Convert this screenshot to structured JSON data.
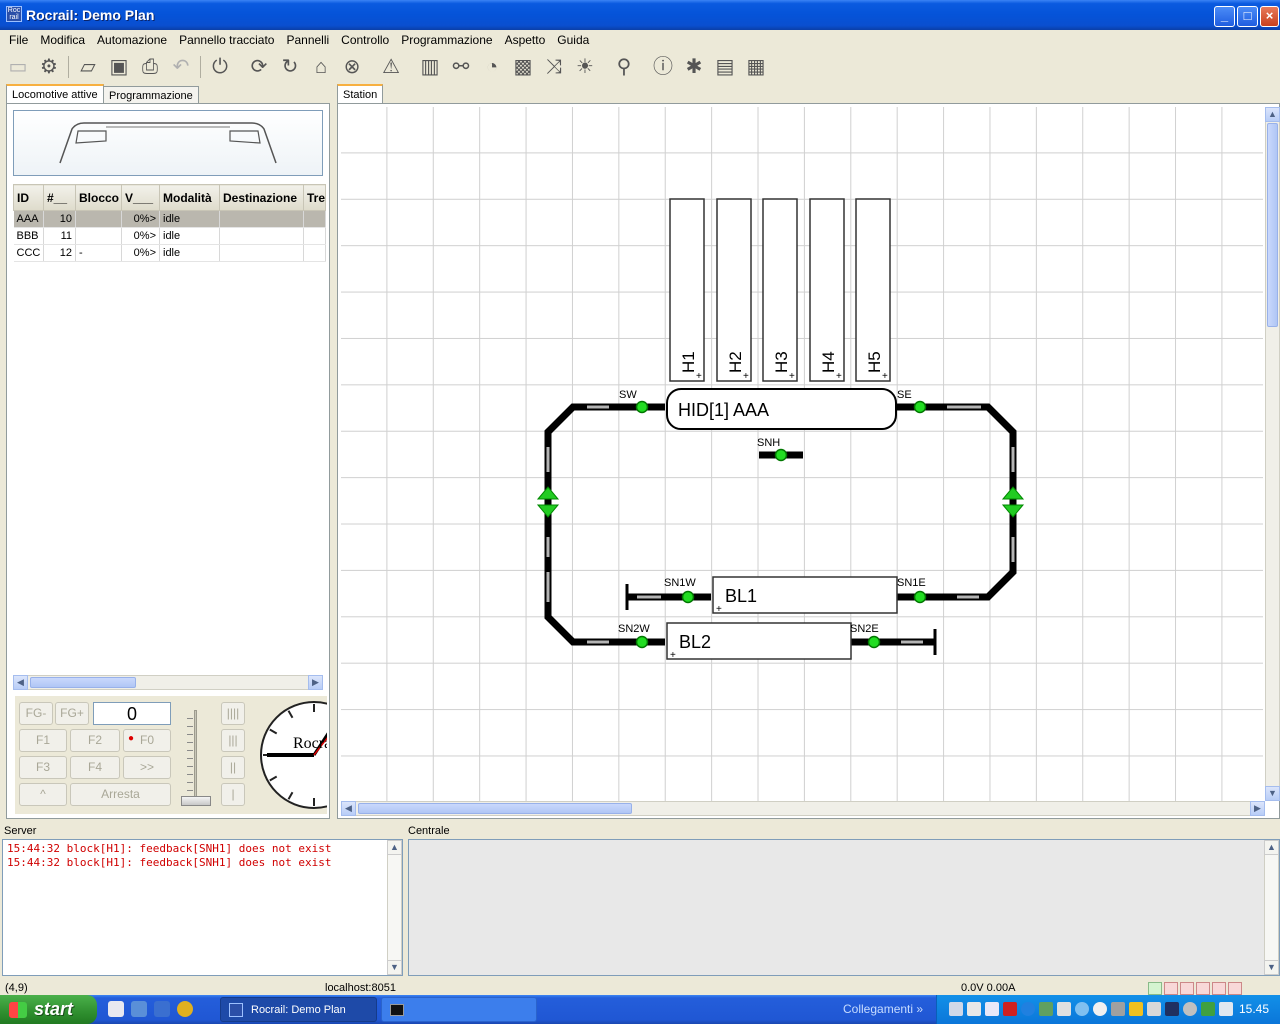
{
  "window": {
    "title": "Rocrail: Demo Plan",
    "app_icon_text": "Roc\nrail"
  },
  "menu": [
    "File",
    "Modifica",
    "Automazione",
    "Pannello tracciato",
    "Pannelli",
    "Controllo",
    "Programmazione",
    "Aspetto",
    "Guida"
  ],
  "left": {
    "tabs": [
      "Locomotive attive",
      "Programmazione"
    ],
    "table": {
      "columns": [
        "ID",
        "#__",
        "Blocco",
        "V___",
        "Modalità",
        "Destinazione",
        "Tre"
      ],
      "rows": [
        {
          "id": "AAA",
          "addr": "10",
          "block": "",
          "speed": "0%>",
          "mode": "idle",
          "dest": "",
          "train": ""
        },
        {
          "id": "BBB",
          "addr": "11",
          "block": "",
          "speed": "0%>",
          "mode": "idle",
          "dest": "",
          "train": ""
        },
        {
          "id": "CCC",
          "addr": "12",
          "block": "-",
          "speed": "0%>",
          "mode": "idle",
          "dest": "",
          "train": ""
        }
      ]
    },
    "controls": {
      "fg_minus": "FG-",
      "fg_plus": "FG+",
      "display": "0",
      "f1": "F1",
      "f2": "F2",
      "f0": "F0",
      "f3": "F3",
      "f4": "F4",
      "next": ">>",
      "dir": "^",
      "stop": "Arresta",
      "speed_btns": [
        "||||",
        "|||",
        "||",
        "|"
      ],
      "clock_label": "Rocrail"
    }
  },
  "plan": {
    "tab": "Station",
    "blocks_vertical": [
      "H1",
      "H2",
      "H3",
      "H4",
      "H5"
    ],
    "block_main": "HID[1] AAA",
    "block_bl1": "BL1",
    "block_bl2": "BL2",
    "sensors": {
      "sw": "SW",
      "se": "SE",
      "snh": "SNH",
      "sn1w": "SN1W",
      "sn1e": "SN1E",
      "sn2w": "SN2W",
      "sn2e": "SN2E"
    }
  },
  "bottom": {
    "server_label": "Server",
    "centrale_label": "Centrale",
    "server_lines": [
      "15:44:32 block[H1]: feedback[SNH1] does not exist",
      "15:44:32 block[H1]: feedback[SNH1] does not exist"
    ]
  },
  "status": {
    "coords": "(4,9)",
    "host": "localhost:8051",
    "power": "0.0V 0.00A"
  },
  "taskbar": {
    "start": "start",
    "tasks": [
      "Rocrail: Demo Plan",
      ""
    ],
    "links": "Collegamenti",
    "time": "15.45"
  },
  "colors": {
    "accent": "#0553d8",
    "sensor_green": "#00cc00",
    "error_red": "#d00000"
  }
}
